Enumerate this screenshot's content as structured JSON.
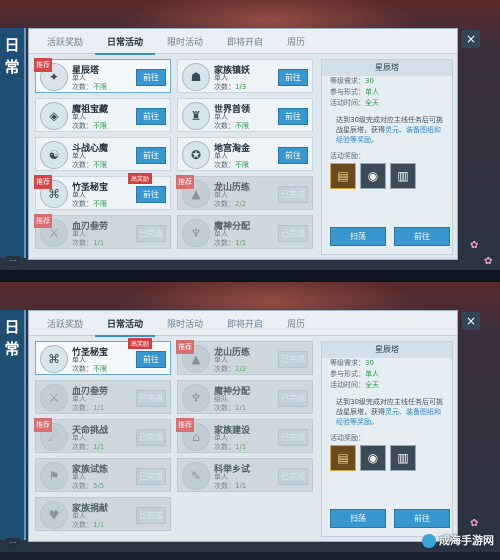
{
  "side_label": [
    "日",
    "常"
  ],
  "tabs": [
    "活跃奖励",
    "日常活动",
    "限时活动",
    "即将开启",
    "周历"
  ],
  "active_tab": 1,
  "accent_color": "#3897cf",
  "panel1": {
    "activities": [
      {
        "name": "星辰塔",
        "type": "单人",
        "count_label": "次数：",
        "count": "不限",
        "button": "前往",
        "tag": "推荐",
        "icon": "star-icon",
        "locked": false
      },
      {
        "name": "家族镇妖",
        "type": "单人",
        "count_label": "次数：",
        "count": "1/3",
        "button": "前往",
        "tag": "",
        "icon": "monster-icon",
        "locked": false
      },
      {
        "name": "魔祖宝藏",
        "type": "单人",
        "count_label": "次数：",
        "count": "不限",
        "button": "前往",
        "tag": "",
        "icon": "treasure-icon",
        "locked": false
      },
      {
        "name": "世界首领",
        "type": "单人",
        "count_label": "次数：",
        "count": "不限",
        "button": "前往",
        "tag": "",
        "icon": "boss-icon",
        "locked": false
      },
      {
        "name": "斗战心魔",
        "type": "单人",
        "count_label": "次数：",
        "count": "不限",
        "button": "前往",
        "tag": "",
        "icon": "demon-icon",
        "locked": false
      },
      {
        "name": "地宫淘金",
        "type": "单人",
        "count_label": "次数：",
        "count": "不限",
        "button": "前往",
        "tag": "",
        "icon": "gold-icon",
        "locked": false
      },
      {
        "name": "竹圣秘宝",
        "type": "单人",
        "count_label": "次数：",
        "count": "不限",
        "button": "前往",
        "tag": "推荐",
        "icon": "bamboo-icon",
        "locked": false,
        "ribbon": "高奖励"
      },
      {
        "name": "龙山历练",
        "type": "单人",
        "count_label": "次数：",
        "count": "2/2",
        "button": "已完成",
        "tag": "推荐",
        "icon": "mountain-icon",
        "locked": true
      },
      {
        "name": "血刃叁劳",
        "type": "单人",
        "count_label": "次数：",
        "count": "1/1",
        "button": "已完成",
        "tag": "推荐",
        "icon": "blade-icon",
        "locked": true
      },
      {
        "name": "魔神分配",
        "type": "单人",
        "count_label": "次数：",
        "count": "1/1",
        "button": "已完成",
        "tag": "",
        "icon": "god-icon",
        "locked": true
      }
    ],
    "detail": {
      "title": "星辰塔",
      "rows": [
        {
          "label": "等级需求：",
          "value": "30"
        },
        {
          "label": "参与形式：",
          "value": "单人"
        },
        {
          "label": "活动时间：",
          "value": "全天"
        }
      ],
      "desc_a": "达到30级完成对应主线任务后可挑战星辰塔，获得",
      "desc_link": "灵元、装备图纸和经验等奖励",
      "desc_b": "。",
      "reward_label": "活动奖励：",
      "rewards": [
        "scroll-icon",
        "orb-icon",
        "book-icon"
      ],
      "btn_sweep": "扫荡",
      "btn_go": "前往"
    }
  },
  "panel2": {
    "activities": [
      {
        "name": "竹圣秘宝",
        "type": "单人",
        "count_label": "次数：",
        "count": "不限",
        "button": "前往",
        "tag": "",
        "icon": "bamboo-icon",
        "locked": false,
        "ribbon": "高奖励"
      },
      {
        "name": "龙山历练",
        "type": "单人",
        "count_label": "次数：",
        "count": "2/2",
        "button": "已完成",
        "tag": "推荐",
        "icon": "mountain-icon",
        "locked": true
      },
      {
        "name": "血刃叁劳",
        "type": "单人",
        "count_label": "次数：",
        "count": "1/1",
        "button": "已完成",
        "tag": "",
        "icon": "blade-icon",
        "locked": true
      },
      {
        "name": "魔神分配",
        "type": "组队",
        "count_label": "次数：",
        "count": "1/1",
        "button": "已完成",
        "tag": "",
        "icon": "god-icon",
        "locked": true
      },
      {
        "name": "天命挑战",
        "type": "单人",
        "count_label": "次数：",
        "count": "1/1",
        "button": "已完成",
        "tag": "推荐",
        "icon": "fate-icon",
        "locked": true
      },
      {
        "name": "家族建设",
        "type": "单人",
        "count_label": "次数：",
        "count": "1/1",
        "button": "已完成",
        "tag": "推荐",
        "icon": "clan-icon",
        "locked": true
      },
      {
        "name": "家族试炼",
        "type": "单人",
        "count_label": "次数：",
        "count": "5/5",
        "button": "已完成",
        "tag": "",
        "icon": "trial-icon",
        "locked": true
      },
      {
        "name": "科举乡试",
        "type": "单人",
        "count_label": "次数：",
        "count": "1/1",
        "button": "已完成",
        "tag": "",
        "icon": "exam-icon",
        "locked": true
      },
      {
        "name": "家族捐献",
        "type": "单人",
        "count_label": "次数：",
        "count": "1/1",
        "button": "已完成",
        "tag": "",
        "icon": "donate-icon",
        "locked": true
      }
    ],
    "detail": {
      "title": "星辰塔",
      "rows": [
        {
          "label": "等级需求：",
          "value": "30"
        },
        {
          "label": "参与形式：",
          "value": "单人"
        },
        {
          "label": "活动时间：",
          "value": "全天"
        }
      ],
      "desc_a": "达到30级完成对应主线任务后可挑战星辰塔，获得",
      "desc_link": "灵元、装备图纸和经验等奖励",
      "desc_b": "。",
      "reward_label": "活动奖励：",
      "rewards": [
        "scroll-icon",
        "orb-icon",
        "book-icon"
      ],
      "btn_sweep": "扫荡",
      "btn_go": "前往"
    }
  },
  "close_glyph": "×",
  "chat_glyph": "···",
  "watermark": "成海手游网"
}
